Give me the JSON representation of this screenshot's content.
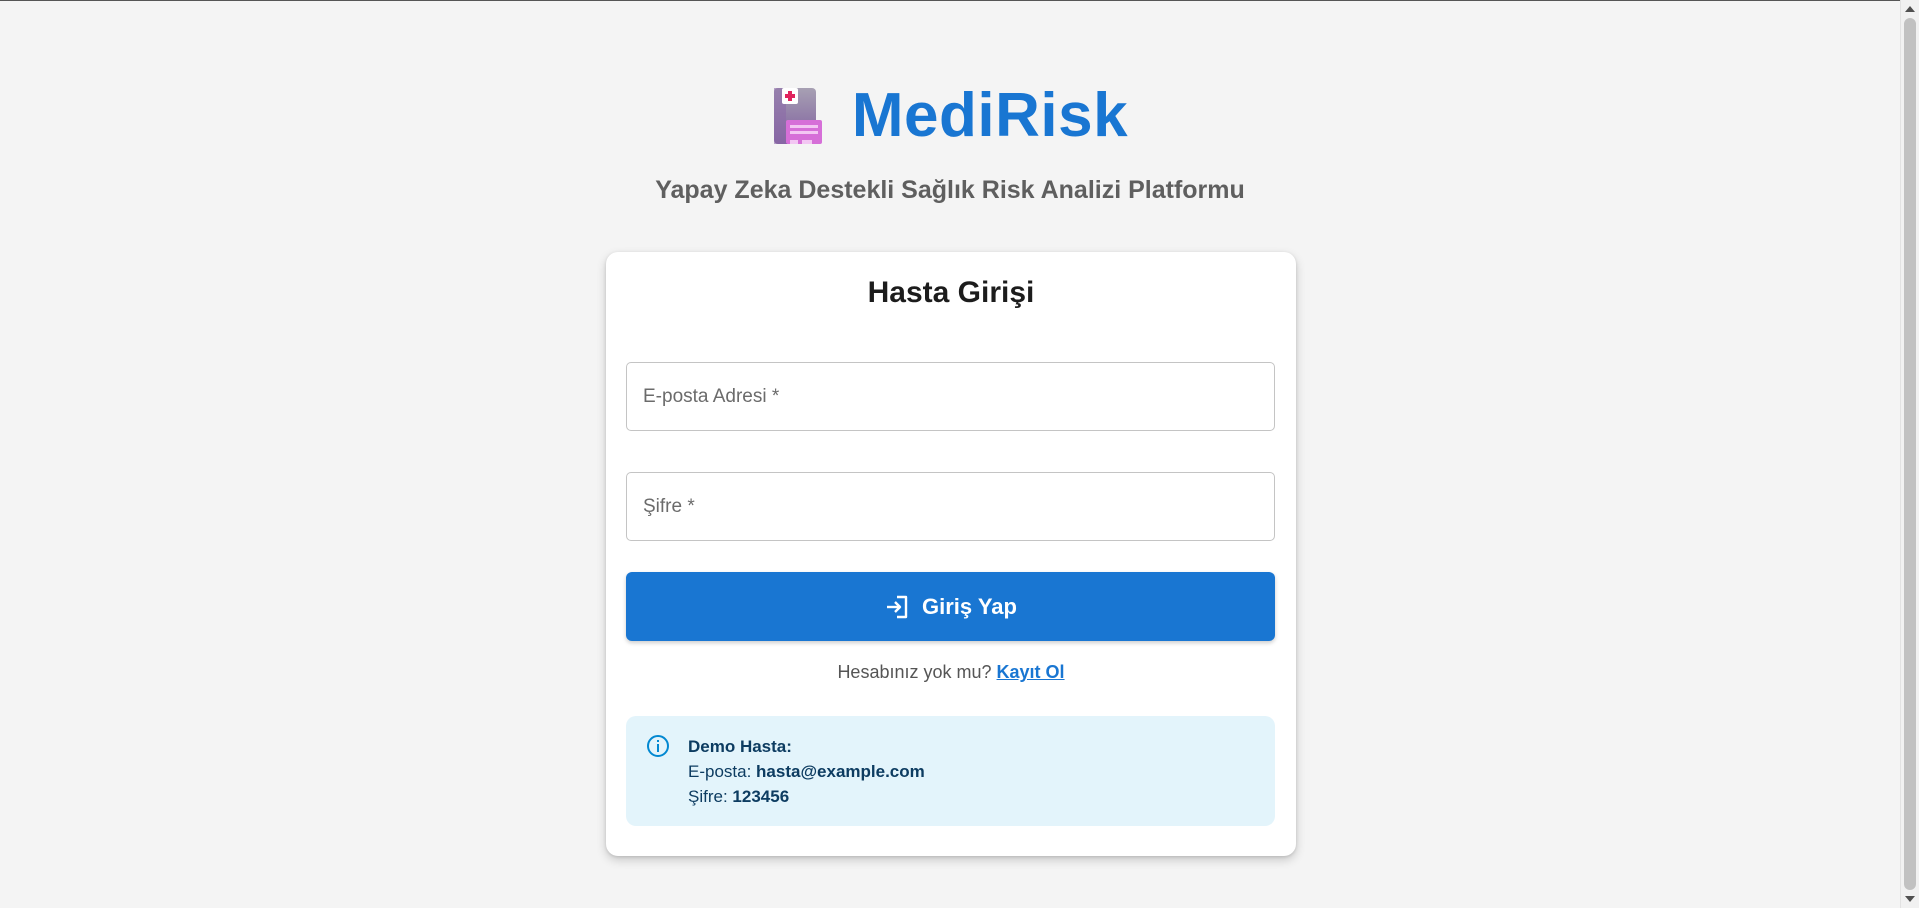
{
  "app": {
    "name": "MediRisk",
    "tagline": "Yapay Zeka Destekli Sağlık Risk Analizi Platformu"
  },
  "login": {
    "title": "Hasta Girişi",
    "email_placeholder": "E-posta Adresi *",
    "email_value": "",
    "password_placeholder": "Şifre *",
    "password_value": "",
    "submit_label": "Giriş Yap",
    "submit_icon": "login-icon"
  },
  "register": {
    "prompt": "Hesabınız yok mu?",
    "link_label": "Kayıt Ol"
  },
  "demo": {
    "icon": "info-icon",
    "heading": "Demo Hasta:",
    "email_label": "E-posta:",
    "email_value": "hasta@example.com",
    "password_label": "Şifre:",
    "password_value": "123456"
  },
  "colors": {
    "primary": "#1976d2",
    "background": "#f4f4f4",
    "info_background": "#e3f4fb",
    "info_text": "#0d3c61"
  }
}
